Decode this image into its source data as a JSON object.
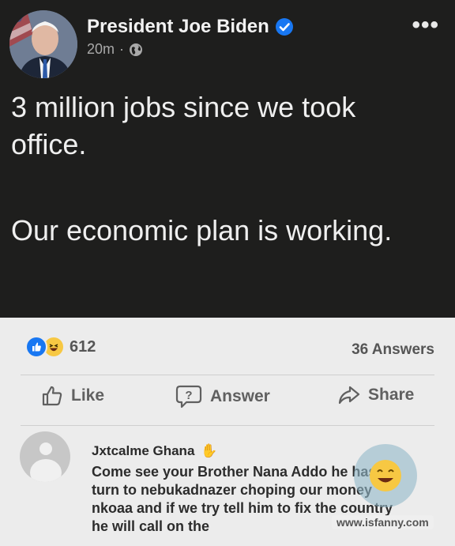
{
  "post": {
    "author": "President Joe Biden",
    "time": "20m",
    "dot": "·",
    "more": "•••",
    "text_line1": "3 million jobs since we took office.",
    "text_line2": "Our economic plan is working."
  },
  "engagement": {
    "reaction_count": "612",
    "answers": "36 Answers"
  },
  "actions": {
    "like": "Like",
    "answer": "Answer",
    "share": "Share"
  },
  "comment": {
    "author": "Jxtcalme Ghana",
    "text": "Come see your Brother Nana Addo he has turn to nebukadnazer choping our money nkoaa and if we try tell him to fix the country he will call on the"
  },
  "watermark": "www.isfanny.com",
  "colors": {
    "dark_bg": "#1e1e1d",
    "light_bg": "#ececec",
    "verified": "#1877f2",
    "like_reaction": "#1877f2",
    "haha_reaction": "#f7c843"
  }
}
